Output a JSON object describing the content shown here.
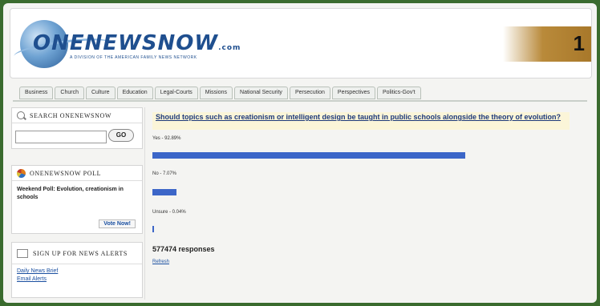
{
  "header": {
    "logo_text": "ONENEWSNOW",
    "logo_suffix": ".com",
    "logo_tagline": "A DIVISION OF THE AMERICAN FAMILY NEWS NETWORK",
    "badge_number": "1"
  },
  "nav": {
    "tabs": [
      "Business",
      "Church",
      "Culture",
      "Education",
      "Legal-Courts",
      "Missions",
      "National Security",
      "Persecution",
      "Perspectives",
      "Politics-Gov't"
    ]
  },
  "sidebar": {
    "search": {
      "heading": "SEARCH ONENEWSNOW",
      "input_value": "",
      "go_label": "GO"
    },
    "poll": {
      "heading": "ONENEWSNOW POLL",
      "text": "Weekend Poll: Evolution, creationism in schools",
      "vote_label": "Vote Now!"
    },
    "alerts": {
      "heading": "SIGN UP FOR NEWS ALERTS",
      "links": [
        "Daily News Brief",
        "Email Alerts"
      ]
    }
  },
  "poll_result": {
    "question": "Should topics such as creationism or intelligent design be taught in public schools alongside the theory of evolution?",
    "options": [
      {
        "label": "Yes - 92.89%",
        "percent": 92.89
      },
      {
        "label": "No - 7.07%",
        "percent": 7.07
      },
      {
        "label": "Unsure - 0.04%",
        "percent": 0.04
      }
    ],
    "responses": "577474 responses",
    "refresh_label": "Refresh"
  },
  "colors": {
    "bar": "#3c66c8",
    "frame": "#3a6b2e",
    "question_bg": "#fbf5d8",
    "badge": "#b98a3a"
  }
}
